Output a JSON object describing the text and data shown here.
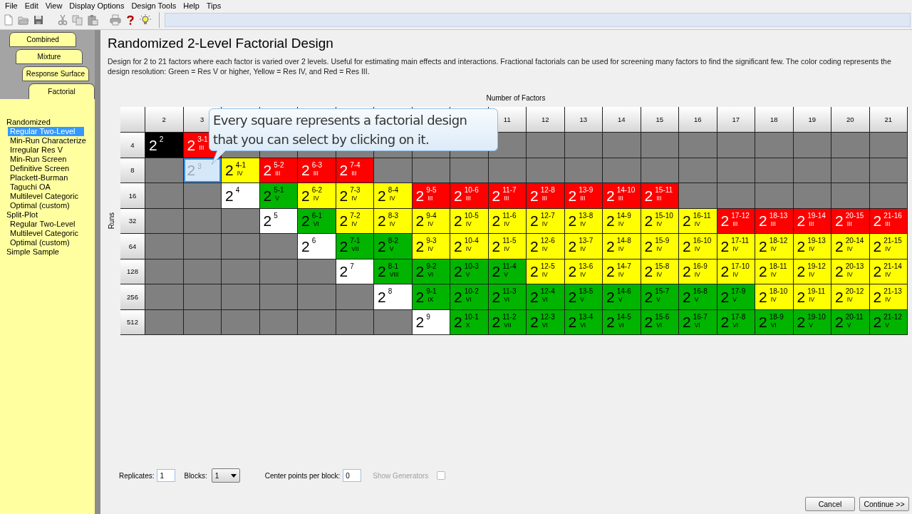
{
  "menu": [
    "File",
    "Edit",
    "View",
    "Display Options",
    "Design Tools",
    "Help",
    "Tips"
  ],
  "sidebar": {
    "tabs": [
      {
        "label": "Combined",
        "selected": false
      },
      {
        "label": "Mixture",
        "selected": false
      },
      {
        "label": "Response Surface",
        "selected": false
      },
      {
        "label": "Factorial",
        "selected": true
      }
    ],
    "items": [
      {
        "label": "Randomized",
        "children": [
          {
            "label": "Regular Two-Level",
            "selected": true
          },
          {
            "label": "Min-Run Characterize",
            "selected": false
          },
          {
            "label": "Irregular Res V",
            "selected": false
          },
          {
            "label": "Min-Run Screen",
            "selected": false
          },
          {
            "label": "Definitive Screen",
            "selected": false
          },
          {
            "label": "Plackett-Burman",
            "selected": false
          },
          {
            "label": "Taguchi OA",
            "selected": false
          },
          {
            "label": "Multilevel Categoric",
            "selected": false
          },
          {
            "label": "Optimal (custom)",
            "selected": false
          }
        ]
      },
      {
        "label": "Split-Plot",
        "children": [
          {
            "label": "Regular Two-Level",
            "selected": false
          },
          {
            "label": "Multilevel Categoric",
            "selected": false
          },
          {
            "label": "Optimal (custom)",
            "selected": false
          }
        ]
      },
      {
        "label": "Simple Sample"
      }
    ]
  },
  "title": "Randomized 2-Level Factorial Design",
  "description": "Design for 2 to 21 factors where each factor is varied over 2 levels.  Useful for estimating main effects and interactions.  Fractional factorials can be used for screening many factors to find the significant few. The color coding represents the design resolution: Green = Res V or higher, Yellow = Res IV, and Red = Res III.",
  "table": {
    "columns_title": "Number of Factors",
    "rows_title": "Runs",
    "columns": [
      {
        "label": "2"
      },
      {
        "label": "3"
      },
      {},
      {},
      {},
      {},
      {},
      {},
      {},
      {
        "label": "11"
      },
      {
        "label": "12"
      },
      {
        "label": "13"
      },
      {
        "label": "14"
      },
      {
        "label": "15"
      },
      {
        "label": "16"
      },
      {
        "label": "17"
      },
      {
        "label": "18"
      },
      {
        "label": "19"
      },
      {
        "label": "20"
      },
      {
        "label": "21"
      }
    ],
    "rows": [
      {
        "label": "4",
        "cells": [
          {
            "kind": "design",
            "base": "2",
            "exp": "2",
            "color": "#000000",
            "selected": false
          },
          {
            "kind": "design",
            "base": "2",
            "exp": "3-1",
            "res": "III",
            "color": "#ff0000",
            "selected": false
          },
          {
            "kind": "empty"
          },
          {
            "kind": "empty"
          },
          {
            "kind": "empty"
          },
          {
            "kind": "empty"
          },
          {
            "kind": "empty"
          },
          {
            "kind": "empty"
          },
          {
            "kind": "empty"
          },
          {
            "kind": "empty"
          },
          {
            "kind": "empty"
          },
          {
            "kind": "empty"
          },
          {
            "kind": "empty"
          },
          {
            "kind": "empty"
          },
          {
            "kind": "empty"
          },
          {
            "kind": "empty"
          },
          {
            "kind": "empty"
          },
          {
            "kind": "empty"
          },
          {
            "kind": "empty"
          },
          {
            "kind": "empty"
          }
        ]
      },
      {
        "label": "8",
        "cells": [
          {
            "kind": "empty"
          },
          {
            "kind": "design",
            "base": "2",
            "exp": "3",
            "color": "#d5e8fa",
            "selected": true
          },
          {
            "kind": "design",
            "base": "2",
            "exp": "4-1",
            "res": "IV",
            "color": "#ffff00",
            "selected": false
          },
          {
            "kind": "design",
            "base": "2",
            "exp": "5-2",
            "res": "III",
            "color": "#ff0000",
            "selected": false
          },
          {
            "kind": "design",
            "base": "2",
            "exp": "6-3",
            "res": "III",
            "color": "#ff0000",
            "selected": false
          },
          {
            "kind": "design",
            "base": "2",
            "exp": "7-4",
            "res": "III",
            "color": "#ff0000",
            "selected": false
          },
          {
            "kind": "empty"
          },
          {
            "kind": "empty"
          },
          {
            "kind": "empty"
          },
          {
            "kind": "empty"
          },
          {
            "kind": "empty"
          },
          {
            "kind": "empty"
          },
          {
            "kind": "empty"
          },
          {
            "kind": "empty"
          },
          {
            "kind": "empty"
          },
          {
            "kind": "empty"
          },
          {
            "kind": "empty"
          },
          {
            "kind": "empty"
          },
          {
            "kind": "empty"
          },
          {
            "kind": "empty"
          }
        ]
      },
      {
        "label": "16",
        "cells": [
          {
            "kind": "empty"
          },
          {
            "kind": "empty"
          },
          {
            "kind": "design",
            "base": "2",
            "exp": "4",
            "color": "#ffffff",
            "selected": false
          },
          {
            "kind": "design",
            "base": "2",
            "exp": "5-1",
            "res": "V",
            "color": "#00b400",
            "selected": false
          },
          {
            "kind": "design",
            "base": "2",
            "exp": "6-2",
            "res": "IV",
            "color": "#ffff00",
            "selected": false
          },
          {
            "kind": "design",
            "base": "2",
            "exp": "7-3",
            "res": "IV",
            "color": "#ffff00",
            "selected": false
          },
          {
            "kind": "design",
            "base": "2",
            "exp": "8-4",
            "res": "IV",
            "color": "#ffff00",
            "selected": false
          },
          {
            "kind": "design",
            "base": "2",
            "exp": "9-5",
            "res": "III",
            "color": "#ff0000",
            "selected": false
          },
          {
            "kind": "design",
            "base": "2",
            "exp": "10-6",
            "res": "III",
            "color": "#ff0000",
            "selected": false
          },
          {
            "kind": "design",
            "base": "2",
            "exp": "11-7",
            "res": "III",
            "color": "#ff0000",
            "selected": false
          },
          {
            "kind": "design",
            "base": "2",
            "exp": "12-8",
            "res": "III",
            "color": "#ff0000",
            "selected": false
          },
          {
            "kind": "design",
            "base": "2",
            "exp": "13-9",
            "res": "III",
            "color": "#ff0000",
            "selected": false
          },
          {
            "kind": "design",
            "base": "2",
            "exp": "14-10",
            "res": "III",
            "color": "#ff0000",
            "selected": false
          },
          {
            "kind": "design",
            "base": "2",
            "exp": "15-11",
            "res": "III",
            "color": "#ff0000",
            "selected": false
          },
          {
            "kind": "empty"
          },
          {
            "kind": "empty"
          },
          {
            "kind": "empty"
          },
          {
            "kind": "empty"
          },
          {
            "kind": "empty"
          },
          {
            "kind": "empty"
          }
        ]
      },
      {
        "label": "32",
        "cells": [
          {
            "kind": "empty"
          },
          {
            "kind": "empty"
          },
          {
            "kind": "empty"
          },
          {
            "kind": "design",
            "base": "2",
            "exp": "5",
            "color": "#ffffff",
            "selected": false
          },
          {
            "kind": "design",
            "base": "2",
            "exp": "6-1",
            "res": "VI",
            "color": "#00b400",
            "selected": false
          },
          {
            "kind": "design",
            "base": "2",
            "exp": "7-2",
            "res": "IV",
            "color": "#ffff00",
            "selected": false
          },
          {
            "kind": "design",
            "base": "2",
            "exp": "8-3",
            "res": "IV",
            "color": "#ffff00",
            "selected": false
          },
          {
            "kind": "design",
            "base": "2",
            "exp": "9-4",
            "res": "IV",
            "color": "#ffff00",
            "selected": false
          },
          {
            "kind": "design",
            "base": "2",
            "exp": "10-5",
            "res": "IV",
            "color": "#ffff00",
            "selected": false
          },
          {
            "kind": "design",
            "base": "2",
            "exp": "11-6",
            "res": "IV",
            "color": "#ffff00",
            "selected": false
          },
          {
            "kind": "design",
            "base": "2",
            "exp": "12-7",
            "res": "IV",
            "color": "#ffff00",
            "selected": false
          },
          {
            "kind": "design",
            "base": "2",
            "exp": "13-8",
            "res": "IV",
            "color": "#ffff00",
            "selected": false
          },
          {
            "kind": "design",
            "base": "2",
            "exp": "14-9",
            "res": "IV",
            "color": "#ffff00",
            "selected": false
          },
          {
            "kind": "design",
            "base": "2",
            "exp": "15-10",
            "res": "IV",
            "color": "#ffff00",
            "selected": false
          },
          {
            "kind": "design",
            "base": "2",
            "exp": "16-11",
            "res": "IV",
            "color": "#ffff00",
            "selected": false
          },
          {
            "kind": "design",
            "base": "2",
            "exp": "17-12",
            "res": "III",
            "color": "#ff0000",
            "selected": false
          },
          {
            "kind": "design",
            "base": "2",
            "exp": "18-13",
            "res": "III",
            "color": "#ff0000",
            "selected": false
          },
          {
            "kind": "design",
            "base": "2",
            "exp": "19-14",
            "res": "III",
            "color": "#ff0000",
            "selected": false
          },
          {
            "kind": "design",
            "base": "2",
            "exp": "20-15",
            "res": "III",
            "color": "#ff0000",
            "selected": false
          },
          {
            "kind": "design",
            "base": "2",
            "exp": "21-16",
            "res": "III",
            "color": "#ff0000",
            "selected": false
          }
        ]
      },
      {
        "label": "64",
        "cells": [
          {
            "kind": "empty"
          },
          {
            "kind": "empty"
          },
          {
            "kind": "empty"
          },
          {
            "kind": "empty"
          },
          {
            "kind": "design",
            "base": "2",
            "exp": "6",
            "color": "#ffffff",
            "selected": false
          },
          {
            "kind": "design",
            "base": "2",
            "exp": "7-1",
            "res": "VII",
            "color": "#00b400",
            "selected": false
          },
          {
            "kind": "design",
            "base": "2",
            "exp": "8-2",
            "res": "V",
            "color": "#00b400",
            "selected": false
          },
          {
            "kind": "design",
            "base": "2",
            "exp": "9-3",
            "res": "IV",
            "color": "#ffff00",
            "selected": false
          },
          {
            "kind": "design",
            "base": "2",
            "exp": "10-4",
            "res": "IV",
            "color": "#ffff00",
            "selected": false
          },
          {
            "kind": "design",
            "base": "2",
            "exp": "11-5",
            "res": "IV",
            "color": "#ffff00",
            "selected": false
          },
          {
            "kind": "design",
            "base": "2",
            "exp": "12-6",
            "res": "IV",
            "color": "#ffff00",
            "selected": false
          },
          {
            "kind": "design",
            "base": "2",
            "exp": "13-7",
            "res": "IV",
            "color": "#ffff00",
            "selected": false
          },
          {
            "kind": "design",
            "base": "2",
            "exp": "14-8",
            "res": "IV",
            "color": "#ffff00",
            "selected": false
          },
          {
            "kind": "design",
            "base": "2",
            "exp": "15-9",
            "res": "IV",
            "color": "#ffff00",
            "selected": false
          },
          {
            "kind": "design",
            "base": "2",
            "exp": "16-10",
            "res": "IV",
            "color": "#ffff00",
            "selected": false
          },
          {
            "kind": "design",
            "base": "2",
            "exp": "17-11",
            "res": "IV",
            "color": "#ffff00",
            "selected": false
          },
          {
            "kind": "design",
            "base": "2",
            "exp": "18-12",
            "res": "IV",
            "color": "#ffff00",
            "selected": false
          },
          {
            "kind": "design",
            "base": "2",
            "exp": "19-13",
            "res": "IV",
            "color": "#ffff00",
            "selected": false
          },
          {
            "kind": "design",
            "base": "2",
            "exp": "20-14",
            "res": "IV",
            "color": "#ffff00",
            "selected": false
          },
          {
            "kind": "design",
            "base": "2",
            "exp": "21-15",
            "res": "IV",
            "color": "#ffff00",
            "selected": false
          }
        ]
      },
      {
        "label": "128",
        "cells": [
          {
            "kind": "empty"
          },
          {
            "kind": "empty"
          },
          {
            "kind": "empty"
          },
          {
            "kind": "empty"
          },
          {
            "kind": "empty"
          },
          {
            "kind": "design",
            "base": "2",
            "exp": "7",
            "color": "#ffffff",
            "selected": false
          },
          {
            "kind": "design",
            "base": "2",
            "exp": "8-1",
            "res": "VIII",
            "color": "#00b400",
            "selected": false
          },
          {
            "kind": "design",
            "base": "2",
            "exp": "9-2",
            "res": "VI",
            "color": "#00b400",
            "selected": false
          },
          {
            "kind": "design",
            "base": "2",
            "exp": "10-3",
            "res": "V",
            "color": "#00b400",
            "selected": false
          },
          {
            "kind": "design",
            "base": "2",
            "exp": "11-4",
            "res": "V",
            "color": "#00b400",
            "selected": false
          },
          {
            "kind": "design",
            "base": "2",
            "exp": "12-5",
            "res": "IV",
            "color": "#ffff00",
            "selected": false
          },
          {
            "kind": "design",
            "base": "2",
            "exp": "13-6",
            "res": "IV",
            "color": "#ffff00",
            "selected": false
          },
          {
            "kind": "design",
            "base": "2",
            "exp": "14-7",
            "res": "IV",
            "color": "#ffff00",
            "selected": false
          },
          {
            "kind": "design",
            "base": "2",
            "exp": "15-8",
            "res": "IV",
            "color": "#ffff00",
            "selected": false
          },
          {
            "kind": "design",
            "base": "2",
            "exp": "16-9",
            "res": "IV",
            "color": "#ffff00",
            "selected": false
          },
          {
            "kind": "design",
            "base": "2",
            "exp": "17-10",
            "res": "IV",
            "color": "#ffff00",
            "selected": false
          },
          {
            "kind": "design",
            "base": "2",
            "exp": "18-11",
            "res": "IV",
            "color": "#ffff00",
            "selected": false
          },
          {
            "kind": "design",
            "base": "2",
            "exp": "19-12",
            "res": "IV",
            "color": "#ffff00",
            "selected": false
          },
          {
            "kind": "design",
            "base": "2",
            "exp": "20-13",
            "res": "IV",
            "color": "#ffff00",
            "selected": false
          },
          {
            "kind": "design",
            "base": "2",
            "exp": "21-14",
            "res": "IV",
            "color": "#ffff00",
            "selected": false
          }
        ]
      },
      {
        "label": "256",
        "cells": [
          {
            "kind": "empty"
          },
          {
            "kind": "empty"
          },
          {
            "kind": "empty"
          },
          {
            "kind": "empty"
          },
          {
            "kind": "empty"
          },
          {
            "kind": "empty"
          },
          {
            "kind": "design",
            "base": "2",
            "exp": "8",
            "color": "#ffffff",
            "selected": false
          },
          {
            "kind": "design",
            "base": "2",
            "exp": "9-1",
            "res": "IX",
            "color": "#00b400",
            "selected": false
          },
          {
            "kind": "design",
            "base": "2",
            "exp": "10-2",
            "res": "VI",
            "color": "#00b400",
            "selected": false
          },
          {
            "kind": "design",
            "base": "2",
            "exp": "11-3",
            "res": "VI",
            "color": "#00b400",
            "selected": false
          },
          {
            "kind": "design",
            "base": "2",
            "exp": "12-4",
            "res": "VI",
            "color": "#00b400",
            "selected": false
          },
          {
            "kind": "design",
            "base": "2",
            "exp": "13-5",
            "res": "V",
            "color": "#00b400",
            "selected": false
          },
          {
            "kind": "design",
            "base": "2",
            "exp": "14-6",
            "res": "V",
            "color": "#00b400",
            "selected": false
          },
          {
            "kind": "design",
            "base": "2",
            "exp": "15-7",
            "res": "V",
            "color": "#00b400",
            "selected": false
          },
          {
            "kind": "design",
            "base": "2",
            "exp": "16-8",
            "res": "V",
            "color": "#00b400",
            "selected": false
          },
          {
            "kind": "design",
            "base": "2",
            "exp": "17-9",
            "res": "V",
            "color": "#00b400",
            "selected": false
          },
          {
            "kind": "design",
            "base": "2",
            "exp": "18-10",
            "res": "IV",
            "color": "#ffff00",
            "selected": false
          },
          {
            "kind": "design",
            "base": "2",
            "exp": "19-11",
            "res": "IV",
            "color": "#ffff00",
            "selected": false
          },
          {
            "kind": "design",
            "base": "2",
            "exp": "20-12",
            "res": "IV",
            "color": "#ffff00",
            "selected": false
          },
          {
            "kind": "design",
            "base": "2",
            "exp": "21-13",
            "res": "IV",
            "color": "#ffff00",
            "selected": false
          }
        ]
      },
      {
        "label": "512",
        "cells": [
          {
            "kind": "empty"
          },
          {
            "kind": "empty"
          },
          {
            "kind": "empty"
          },
          {
            "kind": "empty"
          },
          {
            "kind": "empty"
          },
          {
            "kind": "empty"
          },
          {
            "kind": "empty"
          },
          {
            "kind": "design",
            "base": "2",
            "exp": "9",
            "color": "#ffffff",
            "selected": false
          },
          {
            "kind": "design",
            "base": "2",
            "exp": "10-1",
            "res": "X",
            "color": "#00b400",
            "selected": false
          },
          {
            "kind": "design",
            "base": "2",
            "exp": "11-2",
            "res": "VII",
            "color": "#00b400",
            "selected": false
          },
          {
            "kind": "design",
            "base": "2",
            "exp": "12-3",
            "res": "VI",
            "color": "#00b400",
            "selected": false
          },
          {
            "kind": "design",
            "base": "2",
            "exp": "13-4",
            "res": "VI",
            "color": "#00b400",
            "selected": false
          },
          {
            "kind": "design",
            "base": "2",
            "exp": "14-5",
            "res": "VI",
            "color": "#00b400",
            "selected": false
          },
          {
            "kind": "design",
            "base": "2",
            "exp": "15-6",
            "res": "VI",
            "color": "#00b400",
            "selected": false
          },
          {
            "kind": "design",
            "base": "2",
            "exp": "16-7",
            "res": "VI",
            "color": "#00b400",
            "selected": false
          },
          {
            "kind": "design",
            "base": "2",
            "exp": "17-8",
            "res": "VI",
            "color": "#00b400",
            "selected": false
          },
          {
            "kind": "design",
            "base": "2",
            "exp": "18-9",
            "res": "VI",
            "color": "#00b400",
            "selected": false
          },
          {
            "kind": "design",
            "base": "2",
            "exp": "19-10",
            "res": "V",
            "color": "#00b400",
            "selected": false
          },
          {
            "kind": "design",
            "base": "2",
            "exp": "20-11",
            "res": "V",
            "color": "#00b400",
            "selected": false
          },
          {
            "kind": "design",
            "base": "2",
            "exp": "21-12",
            "res": "V",
            "color": "#00b400",
            "selected": false
          }
        ]
      }
    ]
  },
  "tooltip": {
    "text": "Every square represents a factorial design that you can select by clicking on it."
  },
  "options": {
    "replicates": {
      "label": "Replicates:",
      "value": "1"
    },
    "blocks": {
      "label": "Blocks:",
      "value": "1"
    },
    "center_points": {
      "label": "Center points per block:",
      "value": "0"
    },
    "show_generators": {
      "label": "Show Generators",
      "checked": false,
      "disabled": true
    }
  },
  "buttons": [
    {
      "label": "Cancel"
    },
    {
      "label": "Continue >>"
    }
  ]
}
